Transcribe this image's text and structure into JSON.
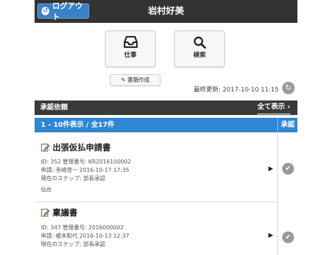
{
  "header": {
    "logout_label": "ログアウト",
    "user_name": "岩村好美"
  },
  "tiles": {
    "work_label": "仕事",
    "search_label": "検索"
  },
  "create_doc_label": "書類作成",
  "last_update": "最終更新: 2017-10-10 11:15",
  "section": {
    "title": "承認依頼",
    "show_all": "全て表示 ›"
  },
  "list": {
    "count_text": "1 - 10件表示 / 全17件",
    "approve_header": "承認",
    "items": [
      {
        "title": "出張仮払申請書",
        "id_line": "ID: 352 管理番号: KR2016100002",
        "applicant_line": "申請: 寺崎啓一 2016-10-17 17:35",
        "step_line": "現在のステップ: 部長承認",
        "location": "仙台"
      },
      {
        "title": "稟議書",
        "id_line": "ID: 347 管理番号: 2016000002",
        "applicant_line": "申請: 榎本和代 2016-10-13 12:37",
        "step_line": "現在のステップ: 部長承認"
      }
    ]
  },
  "colors": {
    "header_bg": "#333333",
    "accent_blue": "#2f86d4",
    "logout_blue": "#3a82c4"
  },
  "icons": [
    "logout-icon",
    "inbox-icon",
    "search-icon",
    "edit-icon",
    "refresh-icon",
    "chevron-right-icon",
    "check-circle-icon"
  ]
}
